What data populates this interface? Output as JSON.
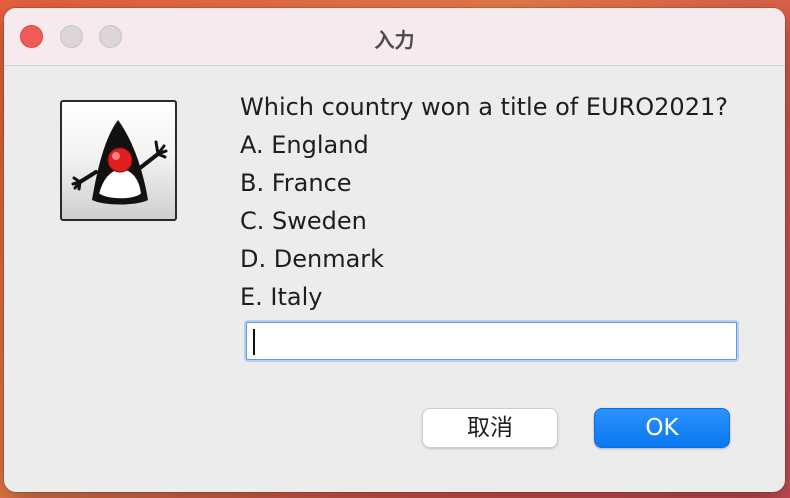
{
  "window": {
    "title": "入力"
  },
  "titlebar": {
    "buttons": [
      {
        "name": "close",
        "color": "#ee5d55"
      },
      {
        "name": "minimize",
        "color": "#dcd6d8"
      },
      {
        "name": "zoom",
        "color": "#dcd6d8"
      }
    ]
  },
  "dialog": {
    "icon": "java-duke-icon",
    "question": "Which country won a title of EURO2021?",
    "options": [
      "A. England",
      "B. France",
      "C. Sweden",
      "D. Denmark",
      "E. Italy"
    ],
    "input": {
      "value": "",
      "placeholder": ""
    },
    "buttons": {
      "cancel_label": "取消",
      "ok_label": "OK"
    }
  },
  "colors": {
    "accent": "#0a78f0",
    "focus_ring": "#5b9af0"
  }
}
